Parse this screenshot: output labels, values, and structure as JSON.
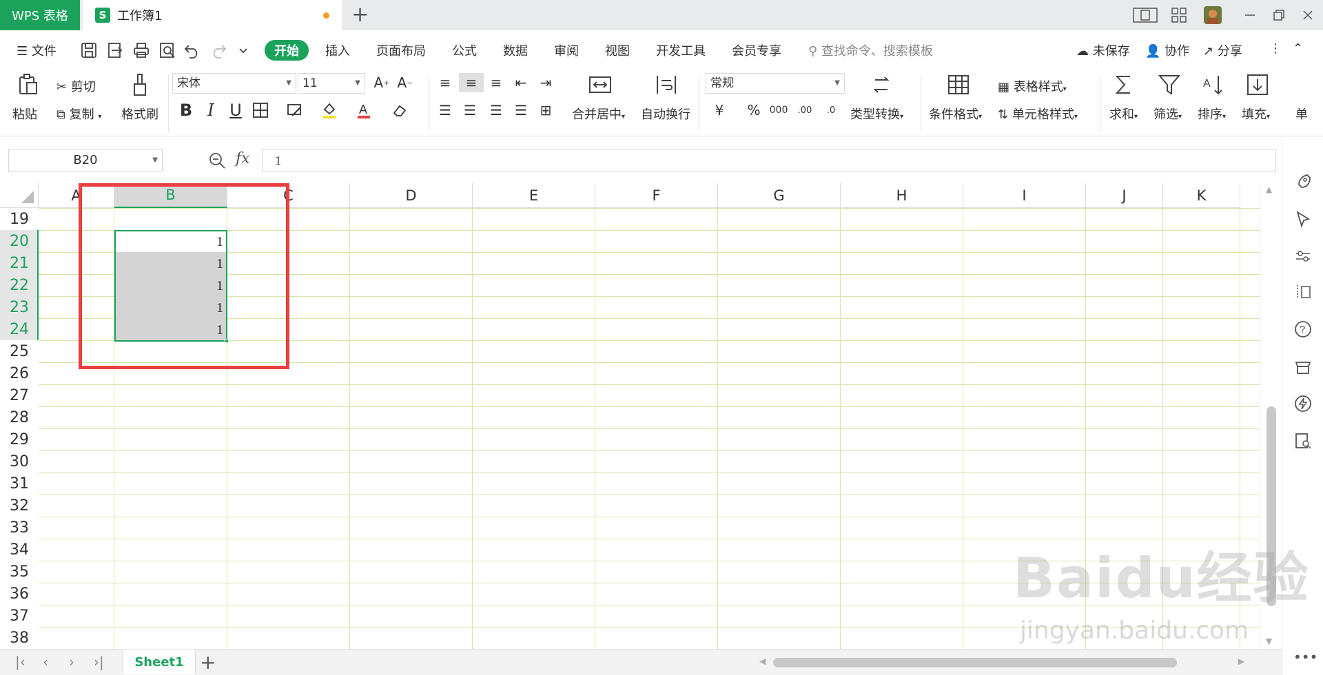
{
  "titlebar": {
    "app_tab": "WPS 表格",
    "doc_icon": "S",
    "doc_name": "工作簿1",
    "new_tab": "+"
  },
  "menubar": {
    "file": "文件",
    "tabs": [
      "开始",
      "插入",
      "页面布局",
      "公式",
      "数据",
      "审阅",
      "视图",
      "开发工具",
      "会员专享"
    ],
    "search_placeholder": "查找命令、搜索模板",
    "unsaved": "未保存",
    "collab": "协作",
    "share": "分享"
  },
  "ribbon": {
    "paste": "粘贴",
    "cut": "剪切",
    "copy": "复制",
    "format_painter": "格式刷",
    "font_name": "宋体",
    "font_size": "11",
    "merge_center": "合并居中",
    "wrap_text": "自动换行",
    "number_format": "常规",
    "type_convert": "类型转换",
    "conditional_format": "条件格式",
    "table_style": "表格样式",
    "cell_style": "单元格样式",
    "sum": "求和",
    "filter": "筛选",
    "sort": "排序",
    "fill": "填充",
    "single": "单"
  },
  "formula": {
    "name_box": "B20",
    "fx": "fx",
    "value": "1"
  },
  "sheet": {
    "columns": [
      "A",
      "B",
      "C",
      "D",
      "E",
      "F",
      "G",
      "H",
      "I",
      "J",
      "K"
    ],
    "rows": [
      "19",
      "20",
      "21",
      "22",
      "23",
      "24",
      "25",
      "26",
      "27",
      "28",
      "29",
      "30",
      "31",
      "32",
      "33",
      "34",
      "35",
      "36",
      "37",
      "38"
    ],
    "selected_column": "B",
    "selected_rows": [
      "20",
      "21",
      "22",
      "23",
      "24"
    ],
    "cell_values": [
      "1",
      "1",
      "1",
      "1",
      "1"
    ]
  },
  "sheetbar": {
    "tab": "Sheet1",
    "add": "+"
  },
  "watermark": {
    "brand": "Baidu经验",
    "url": "jingyan.baidu.com"
  },
  "colors": {
    "accent": "#1ba35c",
    "highlight_box": "#e8413f"
  }
}
